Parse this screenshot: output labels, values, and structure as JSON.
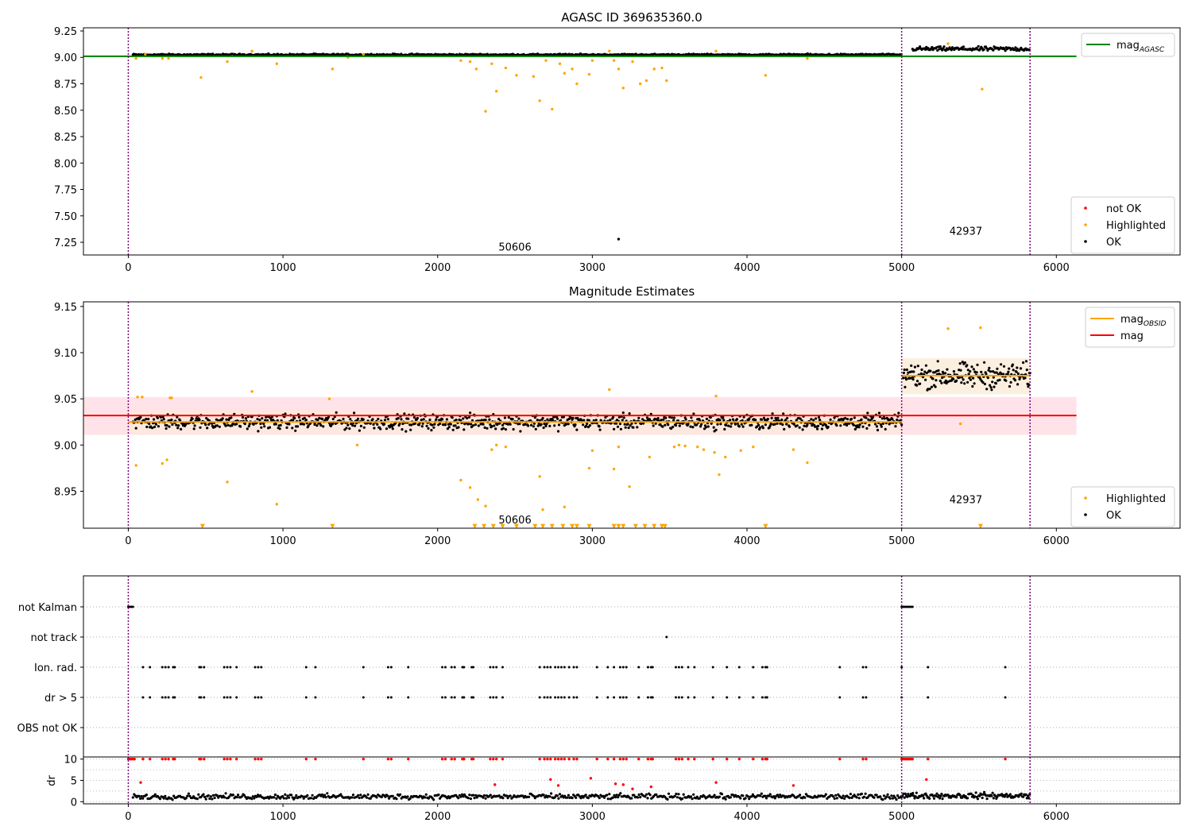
{
  "colors": {
    "ok": "#000000",
    "highlighted": "#FFA500",
    "not_ok": "#FF0000",
    "mag_agasc": "#008000",
    "mag_obsid": "#FFA500",
    "mag": "#FF0000",
    "obsid_boundary": "#800080",
    "mag_band": "#FFC0CB",
    "obsid_band": "#FAEBD7"
  },
  "chart_data": [
    {
      "type": "scatter",
      "title": "AGASC ID 369635360.0",
      "xlim": [
        -290,
        6800
      ],
      "ylim": [
        7.13,
        9.28
      ],
      "xticks": [
        0,
        1000,
        2000,
        3000,
        4000,
        5000,
        6000
      ],
      "yticks": [
        7.25,
        7.5,
        7.75,
        8.0,
        8.25,
        8.5,
        8.75,
        9.0,
        9.25
      ],
      "ytick_labels": [
        "7.25",
        "7.50",
        "7.75",
        "8.00",
        "8.25",
        "8.50",
        "8.75",
        "9.00",
        "9.25"
      ],
      "obsid_boundaries": [
        0,
        5000,
        5830
      ],
      "obsid_labels": [
        {
          "text": "50606",
          "x": 2500,
          "y": 7.17
        },
        {
          "text": "42937",
          "x": 5415,
          "y": 7.32
        }
      ],
      "hlines": [
        {
          "name": "mag",
          "sub": "AGASC",
          "y": 9.01,
          "x0": -290,
          "x1": 6130,
          "color_key": "mag_agasc"
        }
      ],
      "legend_upper": {
        "placement": "top-right",
        "entries": [
          {
            "label": "mag",
            "sub": "AGASC",
            "color_key": "mag_agasc",
            "kind": "line"
          }
        ]
      },
      "legend_lower": {
        "placement": "bottom-right",
        "entries": [
          {
            "label": "not OK",
            "color_key": "not_ok",
            "kind": "dot"
          },
          {
            "label": "Highlighted",
            "color_key": "highlighted",
            "kind": "dot"
          },
          {
            "label": "OK",
            "color_key": "ok",
            "kind": "dot"
          }
        ]
      },
      "series": [
        {
          "name": "OK",
          "color_key": "ok",
          "kind": "band",
          "segments": [
            {
              "x0": 30,
              "x1": 5000,
              "y": 9.025,
              "spread": 0.012,
              "step": 6
            },
            {
              "x0": 5070,
              "x1": 5830,
              "y": 9.08,
              "spread": 0.03,
              "step": 6
            }
          ]
        },
        {
          "name": "Highlighted",
          "color_key": "highlighted",
          "kind": "points",
          "x": [
            50,
            110,
            220,
            260,
            470,
            640,
            800,
            960,
            1320,
            1420,
            1520,
            2150,
            2210,
            2250,
            2310,
            2350,
            2380,
            2440,
            2510,
            2620,
            2660,
            2700,
            2740,
            2790,
            2820,
            2870,
            2900,
            2980,
            3000,
            3110,
            3140,
            3170,
            3200,
            3260,
            3310,
            3350,
            3400,
            3450,
            3480,
            3800,
            4120,
            4390,
            5300,
            5520
          ],
          "y": [
            8.99,
            9.03,
            8.99,
            8.99,
            8.81,
            8.96,
            9.06,
            8.94,
            8.89,
            9.0,
            9.03,
            8.97,
            8.96,
            8.89,
            8.49,
            8.94,
            8.68,
            8.9,
            8.83,
            8.82,
            8.59,
            8.97,
            8.51,
            8.94,
            8.85,
            8.89,
            8.75,
            8.84,
            8.97,
            9.06,
            8.97,
            8.89,
            8.71,
            8.96,
            8.75,
            8.78,
            8.89,
            8.9,
            8.78,
            9.06,
            8.83,
            8.99,
            9.13,
            8.7
          ]
        },
        {
          "name": "Outlier",
          "color_key": "ok",
          "kind": "points",
          "x": [
            3170
          ],
          "y": [
            7.28
          ]
        }
      ]
    },
    {
      "type": "scatter",
      "title": "Magnitude Estimates",
      "xlim": [
        -290,
        6800
      ],
      "ylim": [
        8.91,
        9.155
      ],
      "xticks": [
        0,
        1000,
        2000,
        3000,
        4000,
        5000,
        6000
      ],
      "yticks": [
        8.95,
        9.0,
        9.05,
        9.1,
        9.15
      ],
      "ytick_labels": [
        "8.95",
        "9.00",
        "9.05",
        "9.10",
        "9.15"
      ],
      "obsid_boundaries": [
        0,
        5000,
        5830
      ],
      "obsid_labels": [
        {
          "text": "50606",
          "x": 2500,
          "y": 8.915
        },
        {
          "text": "42937",
          "x": 5415,
          "y": 8.937
        }
      ],
      "bands": [
        {
          "y0": 9.011,
          "y1": 9.052,
          "x0": -290,
          "x1": 6130,
          "color_key": "mag_band",
          "opacity": 0.45
        },
        {
          "y0": 9.012,
          "y1": 9.038,
          "x0": 0,
          "x1": 5000,
          "color_key": "obsid_band",
          "opacity": 0.6
        },
        {
          "y0": 9.055,
          "y1": 9.094,
          "x0": 5000,
          "x1": 5830,
          "color_key": "obsid_band",
          "opacity": 0.8
        }
      ],
      "hlines": [
        {
          "name": "mag",
          "sub": "OBSID",
          "y": 9.025,
          "x0": 0,
          "x1": 5000,
          "color_key": "mag_obsid"
        },
        {
          "name": "mag",
          "sub": "OBSID",
          "y": 9.075,
          "x0": 5000,
          "x1": 5830,
          "color_key": "mag_obsid"
        },
        {
          "name": "mag",
          "sub": "",
          "y": 9.032,
          "x0": -290,
          "x1": 6130,
          "color_key": "mag"
        }
      ],
      "legend_upper": {
        "placement": "top-right",
        "entries": [
          {
            "label": "mag",
            "sub": "OBSID",
            "color_key": "mag_obsid",
            "kind": "line"
          },
          {
            "label": "mag",
            "sub": "",
            "color_key": "mag",
            "kind": "line"
          }
        ]
      },
      "legend_lower": {
        "placement": "bottom-right",
        "entries": [
          {
            "label": "Highlighted",
            "color_key": "highlighted",
            "kind": "dot"
          },
          {
            "label": "OK",
            "color_key": "ok",
            "kind": "dot"
          }
        ]
      },
      "series": [
        {
          "name": "OK",
          "color_key": "ok",
          "kind": "band",
          "segments": [
            {
              "x0": 30,
              "x1": 5000,
              "y": 9.025,
              "spread": 0.012,
              "step": 5
            },
            {
              "x0": 5010,
              "x1": 5830,
              "y": 9.075,
              "spread": 0.02,
              "step": 4
            }
          ]
        },
        {
          "name": "Highlighted",
          "color_key": "highlighted",
          "kind": "points",
          "x": [
            50,
            60,
            90,
            220,
            250,
            270,
            280,
            640,
            800,
            960,
            1300,
            1480,
            2150,
            2210,
            2260,
            2310,
            2350,
            2380,
            2440,
            2660,
            2680,
            2820,
            2980,
            3000,
            3110,
            3140,
            3170,
            3240,
            3370,
            3530,
            3560,
            3600,
            3680,
            3720,
            3790,
            3800,
            3820,
            3860,
            3960,
            4040,
            4300,
            4390,
            5300,
            5380,
            5510
          ],
          "y": [
            8.978,
            9.052,
            9.052,
            8.98,
            8.984,
            9.051,
            9.051,
            8.96,
            9.058,
            8.936,
            9.05,
            9.0,
            8.962,
            8.954,
            8.941,
            8.934,
            8.995,
            9.0,
            8.998,
            8.966,
            8.93,
            8.933,
            8.975,
            8.994,
            9.06,
            8.974,
            8.998,
            8.955,
            8.987,
            8.998,
            9.0,
            8.999,
            8.998,
            8.995,
            8.992,
            9.053,
            8.968,
            8.987,
            8.994,
            8.998,
            8.995,
            8.981,
            9.126,
            9.023,
            9.127
          ]
        },
        {
          "name": "Highlighted (below range)",
          "color_key": "highlighted",
          "kind": "markers",
          "x": [
            480,
            1320,
            2240,
            2300,
            2360,
            2420,
            2510,
            2630,
            2680,
            2740,
            2810,
            2870,
            2900,
            2980,
            3140,
            3170,
            3200,
            3280,
            3340,
            3400,
            3450,
            3470,
            4120,
            5510
          ],
          "y": [
            8.912,
            8.912,
            8.912,
            8.912,
            8.912,
            8.912,
            8.912,
            8.912,
            8.912,
            8.912,
            8.912,
            8.912,
            8.912,
            8.912,
            8.912,
            8.912,
            8.912,
            8.912,
            8.912,
            8.912,
            8.912,
            8.912,
            8.912,
            8.912
          ]
        }
      ]
    },
    {
      "type": "scatter",
      "title": "",
      "xlim": [
        -290,
        6800
      ],
      "categories": [
        "not Kalman",
        "not track",
        "Ion. rad.",
        "dr > 5",
        "OBS not OK"
      ],
      "obsid_boundaries": [
        0,
        5000,
        5830
      ],
      "flags": {
        "not Kalman": [
          0,
          10,
          20,
          30,
          5000,
          5010,
          5020,
          5030,
          5040,
          5050,
          5060,
          5070
        ],
        "not track": [
          3480
        ],
        "Ion. rad.": [
          95,
          140,
          220,
          240,
          260,
          290,
          300,
          460,
          470,
          490,
          620,
          640,
          660,
          700,
          820,
          840,
          860,
          1150,
          1210,
          1520,
          1680,
          1700,
          1810,
          2030,
          2050,
          2090,
          2110,
          2160,
          2170,
          2220,
          2230,
          2340,
          2360,
          2380,
          2420,
          2660,
          2690,
          2710,
          2730,
          2760,
          2780,
          2800,
          2820,
          2850,
          2880,
          2900,
          3030,
          3100,
          3140,
          3180,
          3200,
          3220,
          3300,
          3360,
          3380,
          3390,
          3540,
          3560,
          3580,
          3620,
          3660,
          3780,
          3870,
          3950,
          4040,
          4100,
          4120,
          4130,
          4600,
          4750,
          4770,
          5000,
          5170,
          5670
        ],
        "dr > 5": [
          95,
          140,
          220,
          240,
          260,
          290,
          300,
          460,
          470,
          490,
          620,
          640,
          660,
          700,
          820,
          840,
          860,
          1150,
          1210,
          1520,
          1680,
          1700,
          1810,
          2030,
          2050,
          2090,
          2110,
          2160,
          2170,
          2220,
          2230,
          2340,
          2360,
          2380,
          2420,
          2660,
          2690,
          2710,
          2730,
          2760,
          2780,
          2800,
          2820,
          2850,
          2880,
          2900,
          3030,
          3100,
          3140,
          3180,
          3200,
          3220,
          3300,
          3360,
          3380,
          3390,
          3540,
          3560,
          3580,
          3620,
          3660,
          3780,
          3870,
          3950,
          4040,
          4100,
          4120,
          4130,
          4600,
          4750,
          4770,
          5000,
          5170,
          5670
        ],
        "OBS not OK": []
      }
    },
    {
      "type": "scatter",
      "title": "",
      "ylabel": "dr",
      "xlim": [
        -290,
        6800
      ],
      "ylim": [
        -0.5,
        10.5
      ],
      "xticks": [
        0,
        1000,
        2000,
        3000,
        4000,
        5000,
        6000
      ],
      "yticks": [
        0,
        5,
        10
      ],
      "ytick_labels": [
        "0",
        "5",
        "10"
      ],
      "obsid_boundaries": [
        0,
        5000,
        5830
      ],
      "series": [
        {
          "name": "OK",
          "color_key": "ok",
          "kind": "band",
          "segments": [
            {
              "x0": 30,
              "x1": 5000,
              "y": 1.2,
              "spread": 0.9,
              "step": 8
            },
            {
              "x0": 5000,
              "x1": 5830,
              "y": 1.4,
              "spread": 1.0,
              "step": 6
            }
          ]
        },
        {
          "name": "not OK",
          "color_key": "not_ok",
          "kind": "points",
          "x": [
            0,
            10,
            20,
            30,
            40,
            95,
            140,
            220,
            240,
            260,
            290,
            300,
            460,
            470,
            490,
            620,
            640,
            660,
            700,
            820,
            840,
            860,
            1150,
            1210,
            1520,
            1680,
            1700,
            1810,
            2030,
            2050,
            2090,
            2110,
            2160,
            2170,
            2220,
            2230,
            2340,
            2360,
            2380,
            2420,
            2660,
            2690,
            2710,
            2730,
            2760,
            2780,
            2800,
            2820,
            2850,
            2880,
            2900,
            3030,
            3100,
            3140,
            3180,
            3200,
            3220,
            3300,
            3360,
            3380,
            3390,
            3540,
            3560,
            3580,
            3620,
            3660,
            3780,
            3870,
            3950,
            4040,
            4100,
            4120,
            4130,
            4600,
            4750,
            4770,
            5000,
            5010,
            5020,
            5030,
            5040,
            5050,
            5060,
            5070,
            5170,
            5670
          ],
          "y": [
            10,
            10,
            10,
            10,
            10,
            10,
            10,
            10,
            10,
            10,
            10,
            10,
            10,
            10,
            10,
            10,
            10,
            10,
            10,
            10,
            10,
            10,
            10,
            10,
            10,
            10,
            10,
            10,
            10,
            10,
            10,
            10,
            10,
            10,
            10,
            10,
            10,
            10,
            10,
            10,
            10,
            10,
            10,
            10,
            10,
            10,
            10,
            10,
            10,
            10,
            10,
            10,
            10,
            10,
            10,
            10,
            10,
            10,
            10,
            10,
            10,
            10,
            10,
            10,
            10,
            10,
            10,
            10,
            10,
            10,
            10,
            10,
            10,
            10,
            10,
            10,
            10,
            10,
            10,
            10,
            10,
            10,
            10,
            10,
            10,
            10
          ]
        },
        {
          "name": "not OK (dr)",
          "color_key": "not_ok",
          "kind": "points",
          "x": [
            80,
            2370,
            2730,
            2780,
            2990,
            3150,
            3200,
            3260,
            3380,
            3800,
            4300,
            5160
          ],
          "y": [
            4.5,
            4.0,
            5.2,
            3.8,
            5.5,
            4.2,
            4.0,
            3.0,
            3.5,
            4.5,
            3.8,
            5.2
          ]
        }
      ]
    }
  ]
}
